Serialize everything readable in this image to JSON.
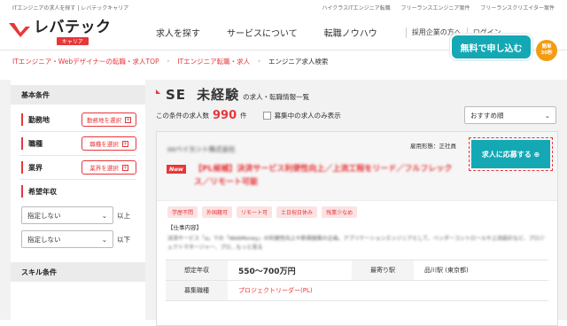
{
  "topbar": {
    "left": "ITエンジニアの求人を探す | レバテックキャリア",
    "links": [
      "ハイクラスITエンジニア転職",
      "フリーランスエンジニア案件",
      "フリーランスクリエイター案件"
    ]
  },
  "header": {
    "logo_main": "レバテック",
    "logo_sub": "キャリア",
    "nav": [
      "求人を探す",
      "サービスについて",
      "転職ノウハウ"
    ],
    "employer_link": "採用企業の方へ",
    "login": "ログイン",
    "apply_label": "無料で申し込む",
    "badge_line1": "簡単",
    "badge_line2": "30秒"
  },
  "breadcrumb": {
    "items": [
      "ITエンジニア・Webデザイナーの転職・求人TOP",
      "ITエンジニア転職・求人",
      "エンジニア求人検索"
    ]
  },
  "sidebar": {
    "basic_heading": "基本条件",
    "rows": [
      {
        "label": "勤務地",
        "button": "勤務地を選択"
      },
      {
        "label": "職種",
        "button": "職種を選択"
      },
      {
        "label": "業界",
        "button": "業界を選択"
      }
    ],
    "salary_label": "希望年収",
    "salary_min": {
      "value": "指定しない",
      "suffix": "以上"
    },
    "salary_max": {
      "value": "指定しない",
      "suffix": "以下"
    },
    "skill_heading": "スキル条件"
  },
  "results": {
    "title_keyword1": "SE",
    "title_keyword2": "未経験",
    "title_suffix": "の求人・転職情報一覧",
    "count_prefix": "この条件の求人数",
    "count": "990",
    "count_unit": "件",
    "open_only_label": "募集中の求人のみ表示",
    "sort": "おすすめ順"
  },
  "job": {
    "company": "ooベイカント株式会社",
    "new_label": "New",
    "title": "【PL候補】決済サービス利便性向上／上流工程をリード／フルフレックス／リモート可能",
    "employment": "雇用形態：正社員",
    "apply_label": "求人に応募する",
    "tags": [
      "学歴不問",
      "外国籍可",
      "リモート可",
      "土日祝日休み",
      "残業少なめ"
    ],
    "desc_heading": "【仕事内容】",
    "desc": "決済サービス「a」での「WebMoney」の利便性向上や新規施策の企画。アプリケーションエンジニアとして、ベンダーコントロールや上流設計など、プロジェクトマネージャー、プロ…もっと見る",
    "salary_key": "想定年収",
    "salary": "550〜700万円",
    "station_key": "最寄り駅",
    "station": "品川駅 (東京都)",
    "role_key": "募集職種",
    "role": "プロジェクトリーダー(PL)"
  }
}
